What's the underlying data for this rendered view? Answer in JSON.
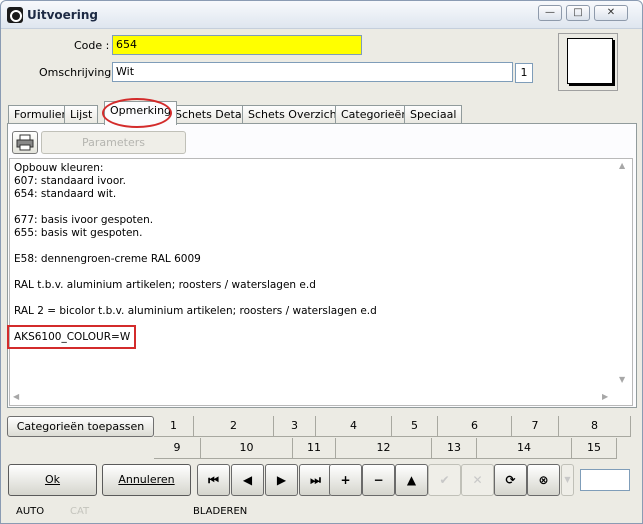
{
  "window": {
    "title": "Uitvoering"
  },
  "caption_buttons": {
    "minimize": "—",
    "maximize": "□",
    "close": "✕"
  },
  "form": {
    "code_label": "Code :",
    "code_value": "654",
    "description_label": "Omschrijving :",
    "description_value": "Wit",
    "count": "1"
  },
  "tabs": [
    "Formulier",
    "Lijst",
    "Opmerking",
    "Schets Detail",
    "Schets Overzicht",
    "Categorieën",
    "Speciaal"
  ],
  "active_tab": "Opmerking",
  "toolbar": {
    "params_label": "Parameters"
  },
  "memo_lines": [
    "Opbouw kleuren:",
    "607: standaard ivoor.",
    "654: standaard wit.",
    "",
    "677: basis ivoor gespoten.",
    "655: basis wit gespoten.",
    "",
    "E58: dennengroen-creme RAL 6009",
    "",
    "RAL t.b.v. aluminium artikelen; roosters / waterslagen e.d",
    "",
    "RAL 2 = bicolor t.b.v. aluminium artikelen; roosters / waterslagen e.d",
    "",
    "AKS6100_COLOUR=W"
  ],
  "categories": {
    "apply_label": "Categorieën toepassen",
    "row1": [
      "1",
      "2",
      "3",
      "4",
      "5",
      "6",
      "7",
      "8"
    ],
    "row2": [
      "9",
      "10",
      "11",
      "12",
      "13",
      "14",
      "15"
    ]
  },
  "buttons": {
    "ok": "Ok",
    "cancel": "Annuleren"
  },
  "nav_icons": [
    "first-record-icon",
    "prev-record-icon",
    "next-record-icon",
    "last-record-icon",
    "add-icon",
    "delete-icon",
    "up-icon",
    "check-icon",
    "cancel-x-icon",
    "refresh-icon",
    "binoculars-icon"
  ],
  "status": {
    "mode": "AUTO",
    "cat": "CAT",
    "state": "BLADEREN"
  },
  "colors": {
    "code_field": "#ffff00",
    "highlight": "#d32b2b"
  }
}
